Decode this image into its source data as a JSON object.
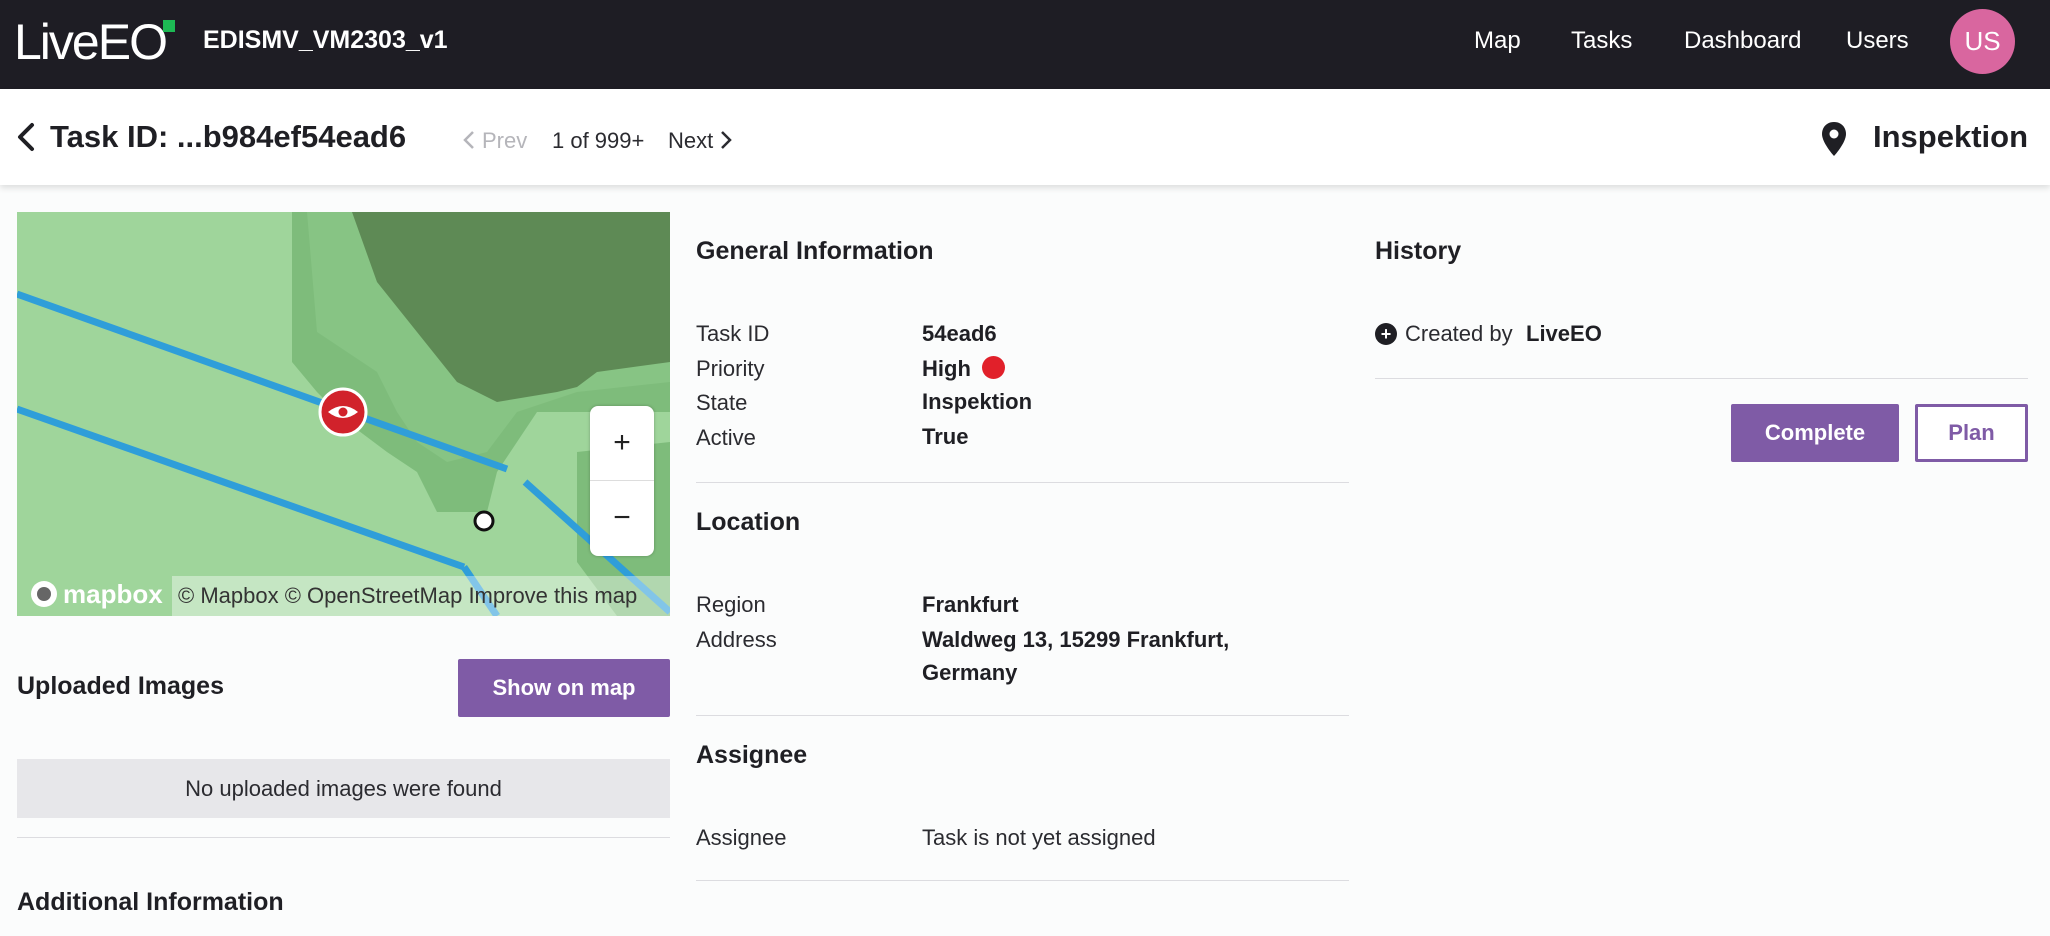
{
  "app": {
    "logo_text": "LiveEO",
    "project_name": "EDISMV_VM2303_v1",
    "colors": {
      "topbar": "#1e1d24",
      "accent": "#7f5ba6",
      "avatar": "#d9669f",
      "priority_high": "#e1202a"
    }
  },
  "nav": {
    "items": [
      {
        "label": "Map"
      },
      {
        "label": "Tasks"
      },
      {
        "label": "Dashboard"
      },
      {
        "label": "Users"
      }
    ],
    "avatar_initials": "US"
  },
  "subheader": {
    "back_icon": "chevron-left-icon",
    "task_title": "Task ID: ...b984ef54ead6",
    "prev_label": "Prev",
    "page_count": "1 of 999+",
    "next_label": "Next",
    "status_icon": "location-pin-icon",
    "status_label": "Inspektion"
  },
  "map": {
    "zoom_in": "+",
    "zoom_out": "−",
    "mapbox_logo": "mapbox",
    "attribution": "© Mapbox © OpenStreetMap Improve this map",
    "marker_icon": "eye-icon"
  },
  "uploaded_images": {
    "title": "Uploaded Images",
    "show_on_map": "Show on map",
    "empty_text": "No uploaded images were found"
  },
  "additional_information": {
    "title": "Additional Information"
  },
  "general_information": {
    "title": "General Information",
    "fields": [
      {
        "label": "Task ID",
        "value": "54ead6"
      },
      {
        "label": "Priority",
        "value": "High"
      },
      {
        "label": "State",
        "value": "Inspektion"
      },
      {
        "label": "Active",
        "value": "True"
      }
    ]
  },
  "location": {
    "title": "Location",
    "region_label": "Region",
    "region_value": "Frankfurt",
    "address_label": "Address",
    "address_line1": "Waldweg 13, 15299 Frankfurt,",
    "address_line2": "Germany"
  },
  "assignee": {
    "title": "Assignee",
    "label": "Assignee",
    "value": "Task is not yet assigned"
  },
  "history": {
    "title": "History",
    "entry_prefix": "Created by",
    "entry_author": "LiveEO",
    "complete_button": "Complete",
    "plan_button": "Plan"
  }
}
